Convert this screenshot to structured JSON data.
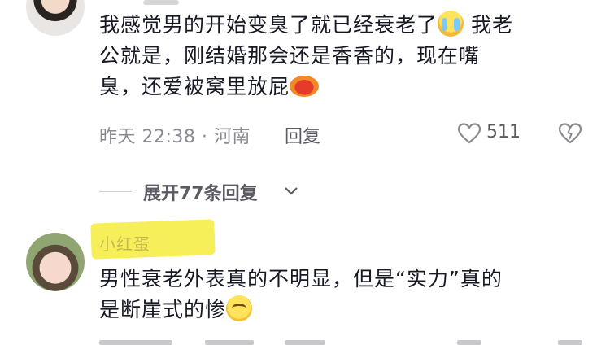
{
  "comment1": {
    "text_line1": "我感觉男的开始变臭了就已经衰老了",
    "text_line1_end": "我老",
    "text_line2": "公就是，刚结婚那会还是香香的，现在嘴",
    "text_line3": "臭，还爱被窝里放屁",
    "emoji1": "loudly-crying-face",
    "emoji2": "lips-emoji",
    "time_location": "昨天 22:38 · 河南",
    "reply_label": "回复",
    "like_count": "511"
  },
  "expand": {
    "label": "展开77条回复"
  },
  "comment2": {
    "username": "小红蛋",
    "text_line1": "男性衰老外表真的不明显，但是“实力”真的",
    "text_line2": "是断崖式的惨",
    "emoji": "pleading-face"
  },
  "colors": {
    "text": "#161823",
    "meta": "#8a8b91",
    "highlight": "#f6ef5a"
  }
}
